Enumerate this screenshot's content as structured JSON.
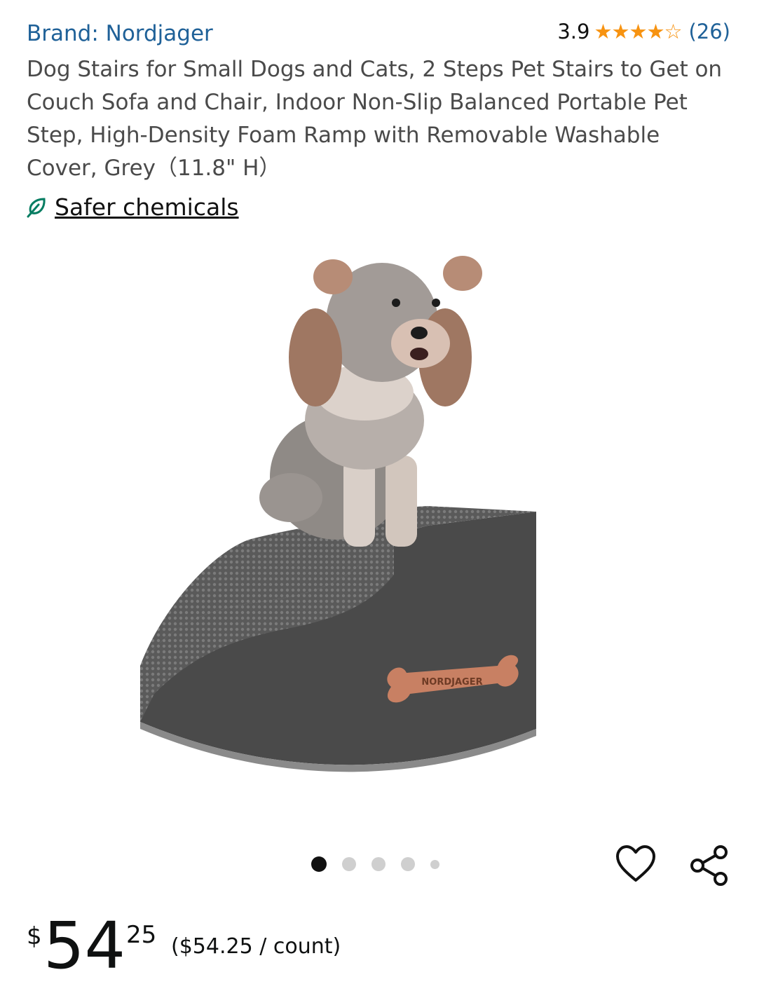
{
  "brand": {
    "label": "Brand: Nordjager"
  },
  "rating": {
    "value": "3.9",
    "stars": 3.9,
    "count": "(26)",
    "star_color": "#f79311"
  },
  "product": {
    "title": "Dog Stairs for Small Dogs and Cats, 2 Steps Pet Stairs to Get on Couch Sofa and Chair, Indoor Non-Slip Balanced Portable Pet Step, High-Density Foam Ramp with Removable Washable Cover, Grey（11.8\" H）",
    "badge_label": "Safer chemicals",
    "badge_icon": "leaf-icon",
    "logo_text": "NORDJAGER"
  },
  "carousel": {
    "total": 5,
    "active_index": 0
  },
  "actions": {
    "wishlist_icon": "heart-icon",
    "share_icon": "share-icon"
  },
  "price": {
    "symbol": "$",
    "whole": "54",
    "fraction": "25",
    "unit_price": "($54.25 / count)"
  },
  "colors": {
    "link": "#1f6198",
    "badge": "#067d62"
  }
}
